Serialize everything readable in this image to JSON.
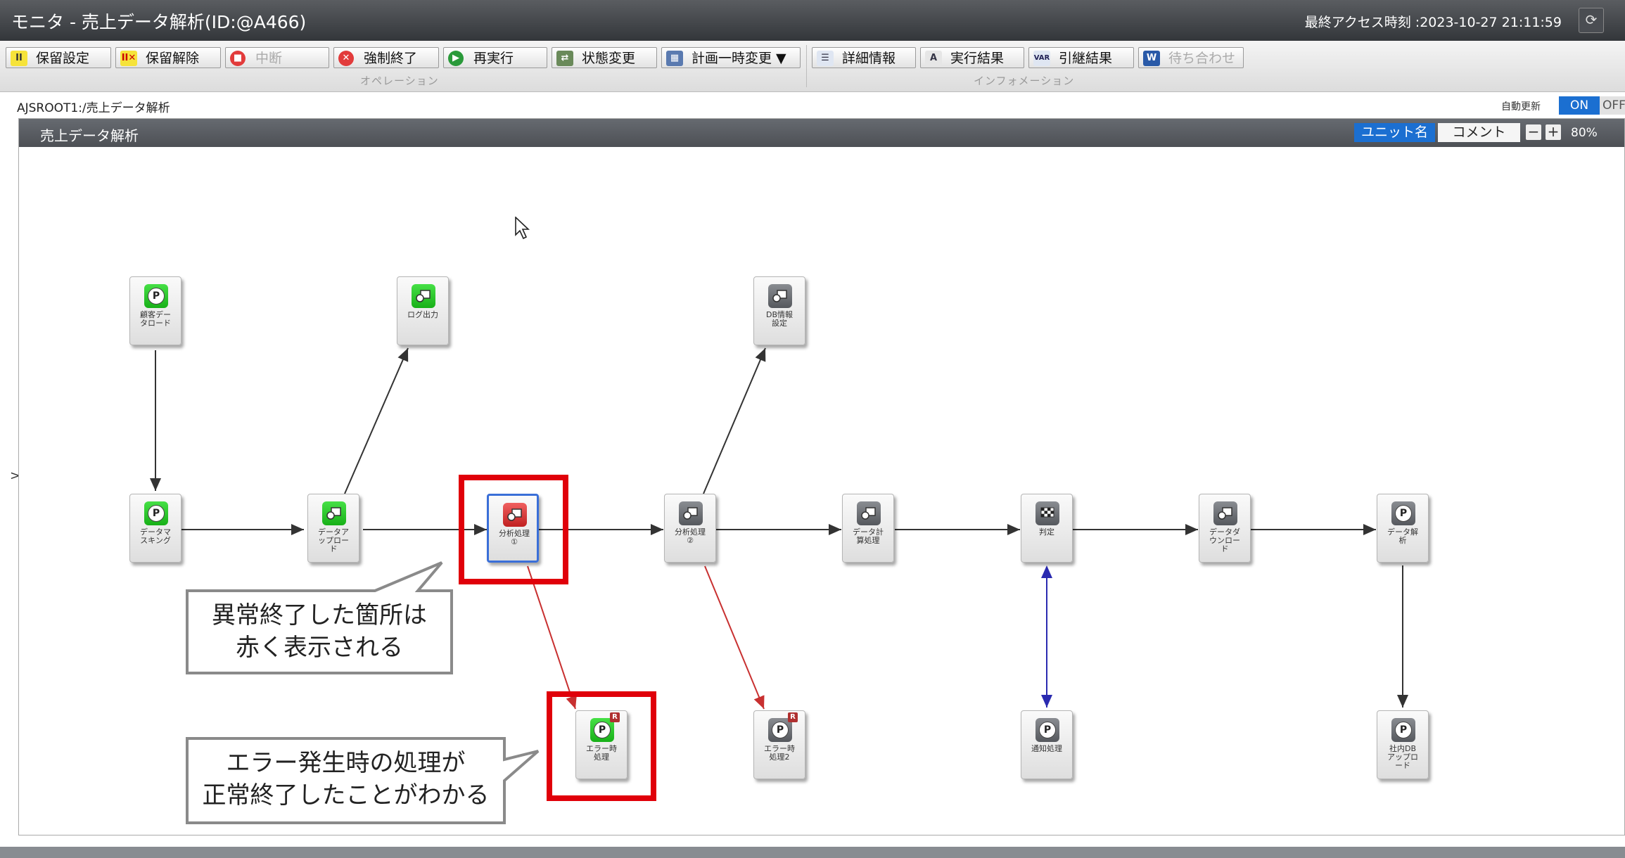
{
  "window": {
    "title": "モニタ - 売上データ解析(ID:@A466)",
    "last_access": "最終アクセス時刻 :2023-10-27 21:11:59"
  },
  "toolbar": {
    "operation_group_label": "オペレーション",
    "information_group_label": "インフォメーション",
    "buttons": {
      "hold": "保留設定",
      "release_hold": "保留解除",
      "interrupt": "中断",
      "kill": "強制終了",
      "rerun": "再実行",
      "change_status": "状態変更",
      "temp_change": "計画一時変更 ▼",
      "detail": "詳細情報",
      "exec_result": "実行結果",
      "inherit_result": "引継結果",
      "wait": "待ち合わせ"
    }
  },
  "path": "AJSROOT1:/売上データ解析",
  "auto_update": {
    "label": "自動更新",
    "on": "ON",
    "off": "OFF"
  },
  "panel": {
    "title": "売上データ解析",
    "unit_name_label": "ユニット名",
    "comment_label": "コメント",
    "zoom_out": "−",
    "zoom_in": "+",
    "zoom": "80%"
  },
  "colors": {
    "accent": "#1b6fd1",
    "error": "#e0000a",
    "normal_end": "#22c022",
    "abnormal_end": "#d63030"
  },
  "nodes": {
    "n_customer": {
      "label": "顧客デー\nタロード",
      "icon": "p-job-icon",
      "status": "normal"
    },
    "n_log": {
      "label": "ログ出力",
      "icon": "job-icon",
      "status": "normal"
    },
    "n_dbinfo": {
      "label": "DB情報\n設定",
      "icon": "job-icon",
      "status": "waiting"
    },
    "n_mask": {
      "label": "データマ\nスキング",
      "icon": "p-job-icon",
      "status": "normal"
    },
    "n_upload": {
      "label": "データア\nップロー\nド",
      "icon": "job-icon",
      "status": "normal"
    },
    "n_analysis1": {
      "label": "分析処理\n①",
      "icon": "job-icon",
      "status": "abnormal"
    },
    "n_analysis2": {
      "label": "分析処理\n②",
      "icon": "job-icon",
      "status": "waiting"
    },
    "n_calc": {
      "label": "データ計\n算処理",
      "icon": "job-icon",
      "status": "waiting"
    },
    "n_judge": {
      "label": "判定",
      "icon": "judge-flag-icon",
      "status": "waiting"
    },
    "n_download": {
      "label": "データダ\nウンロー\nド",
      "icon": "job-icon",
      "status": "waiting"
    },
    "n_dataanalysis": {
      "label": "データ解\n析",
      "icon": "p-job-icon",
      "status": "waiting"
    },
    "n_error1": {
      "label": "エラー時\n処理",
      "icon": "p-job-icon",
      "status": "normal"
    },
    "n_error2": {
      "label": "エラー時\n処理2",
      "icon": "p-job-icon",
      "status": "waiting"
    },
    "n_notify": {
      "label": "通知処理",
      "icon": "p-job-icon",
      "status": "waiting"
    },
    "n_internaldb": {
      "label": "社内DB\nアップロ\nード",
      "icon": "p-job-icon",
      "status": "waiting"
    }
  },
  "callouts": {
    "abnormal": "異常終了した箇所は\n赤く表示される",
    "error_handler": "エラー発生時の処理が\n正常終了したことがわかる"
  },
  "left_toggle": ">"
}
